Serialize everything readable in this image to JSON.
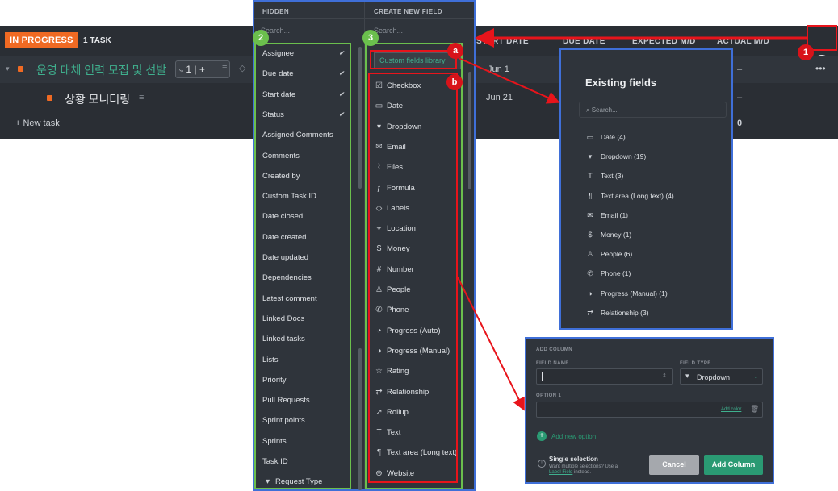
{
  "list": {
    "status_label": "IN PROGRESS",
    "task_count": "1 TASK",
    "columns": [
      "START DATE",
      "DUE DATE",
      "EXPECTED M/D",
      "ACTUAL M/D"
    ],
    "task1": "운영 대체 인력 모집 및 선발",
    "task1_chip": "1 | +",
    "task1_start": "Jun 1",
    "task1_actual": "–",
    "task2": "상황 모니터링",
    "task2_start": "Jun 21",
    "task2_actual": "–",
    "new_task": "+ New task",
    "sum_value": "0",
    "more": "•••",
    "add_column_icon": "+"
  },
  "panel": {
    "hidden_header": "HIDDEN",
    "create_header": "CREATE NEW FIELD",
    "search_placeholder": "Search...",
    "custom_fields_library": "Custom fields library",
    "hidden_items": [
      {
        "label": "Assignee",
        "checked": true
      },
      {
        "label": "Due date",
        "checked": true
      },
      {
        "label": "Start date",
        "checked": true
      },
      {
        "label": "Status",
        "checked": true
      },
      {
        "label": "Assigned Comments"
      },
      {
        "label": "Comments"
      },
      {
        "label": "Created by"
      },
      {
        "label": "Custom Task ID"
      },
      {
        "label": "Date closed"
      },
      {
        "label": "Date created"
      },
      {
        "label": "Date updated"
      },
      {
        "label": "Dependencies"
      },
      {
        "label": "Latest comment"
      },
      {
        "label": "Linked Docs"
      },
      {
        "label": "Linked tasks"
      },
      {
        "label": "Lists"
      },
      {
        "label": "Priority"
      },
      {
        "label": "Pull Requests"
      },
      {
        "label": "Sprint points"
      },
      {
        "label": "Sprints"
      },
      {
        "label": "Task ID"
      },
      {
        "label": "Request Type",
        "icon": "dropdown-icon"
      }
    ],
    "create_items": [
      {
        "label": "Checkbox",
        "icon": "checkbox-icon"
      },
      {
        "label": "Date",
        "icon": "calendar-icon"
      },
      {
        "label": "Dropdown",
        "icon": "dropdown-icon"
      },
      {
        "label": "Email",
        "icon": "email-icon"
      },
      {
        "label": "Files",
        "icon": "paperclip-icon"
      },
      {
        "label": "Formula",
        "icon": "formula-icon"
      },
      {
        "label": "Labels",
        "icon": "tag-icon"
      },
      {
        "label": "Location",
        "icon": "location-pin-icon"
      },
      {
        "label": "Money",
        "icon": "dollar-icon"
      },
      {
        "label": "Number",
        "icon": "hash-icon"
      },
      {
        "label": "People",
        "icon": "person-icon"
      },
      {
        "label": "Phone",
        "icon": "phone-icon"
      },
      {
        "label": "Progress (Auto)",
        "icon": "progress-auto-icon"
      },
      {
        "label": "Progress (Manual)",
        "icon": "progress-manual-icon"
      },
      {
        "label": "Rating",
        "icon": "star-icon"
      },
      {
        "label": "Relationship",
        "icon": "relationship-icon"
      },
      {
        "label": "Rollup",
        "icon": "rollup-arrow-icon"
      },
      {
        "label": "Text",
        "icon": "text-icon"
      },
      {
        "label": "Text area (Long text)",
        "icon": "text-area-icon"
      },
      {
        "label": "Website",
        "icon": "globe-icon"
      }
    ]
  },
  "existing": {
    "title": "Existing fields",
    "search_placeholder": "Search...",
    "items": [
      {
        "label": "Date (4)",
        "icon": "calendar-icon"
      },
      {
        "label": "Dropdown (19)",
        "icon": "dropdown-icon"
      },
      {
        "label": "Text (3)",
        "icon": "text-icon"
      },
      {
        "label": "Text area (Long text) (4)",
        "icon": "text-area-icon"
      },
      {
        "label": "Email (1)",
        "icon": "email-icon"
      },
      {
        "label": "Money (1)",
        "icon": "dollar-icon"
      },
      {
        "label": "People (6)",
        "icon": "person-icon"
      },
      {
        "label": "Phone (1)",
        "icon": "phone-icon"
      },
      {
        "label": "Progress (Manual) (1)",
        "icon": "progress-manual-icon"
      },
      {
        "label": "Relationship (3)",
        "icon": "relationship-icon"
      }
    ]
  },
  "add_column": {
    "header": "ADD COLUMN",
    "field_name_label": "FIELD NAME",
    "field_type_label": "FIELD TYPE",
    "field_type_value": "Dropdown",
    "option_label": "OPTION 1",
    "add_color": "Add color",
    "add_new_option": "Add new option",
    "single_selection": "Single selection",
    "hint_prefix": "Want multiple selections? Use a",
    "hint_link": "Label Field",
    "hint_suffix": "instead.",
    "cancel": "Cancel",
    "submit": "Add Column"
  },
  "annotations": {
    "n1": "1",
    "n2": "2",
    "n3": "3",
    "a": "a",
    "b": "b"
  },
  "colors": {
    "status_orange": "#f06a23",
    "accent_green": "#2a9a73",
    "annotation_red": "#e8141b",
    "annotation_green": "#6bbf4d",
    "panel_border_blue": "#3f6fd8"
  }
}
